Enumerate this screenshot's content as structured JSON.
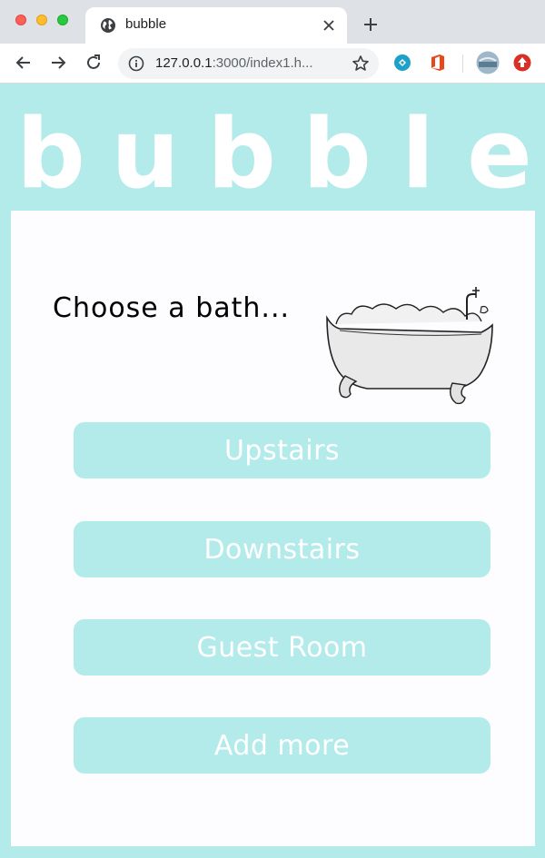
{
  "browser": {
    "tab_title": "bubble",
    "url_host": "127.0.0.1",
    "url_rest": ":3000/index1.h..."
  },
  "page": {
    "logo_letters": [
      "b",
      "u",
      "b",
      "b",
      "l",
      "e"
    ],
    "heading": "Choose a bath...",
    "rooms": [
      "Upstairs",
      "Downstairs",
      "Guest Room",
      "Add more"
    ]
  },
  "colors": {
    "theme": "#b3eaea",
    "card": "#fdfcff",
    "button_text": "#ffffff"
  },
  "icons": {
    "tab_favicon": "globe-icon",
    "tab_close": "close-icon",
    "new_tab": "plus-icon",
    "back": "back-arrow-icon",
    "forward": "forward-arrow-icon",
    "reload": "reload-icon",
    "site_info": "info-icon",
    "bookmark": "star-icon"
  }
}
